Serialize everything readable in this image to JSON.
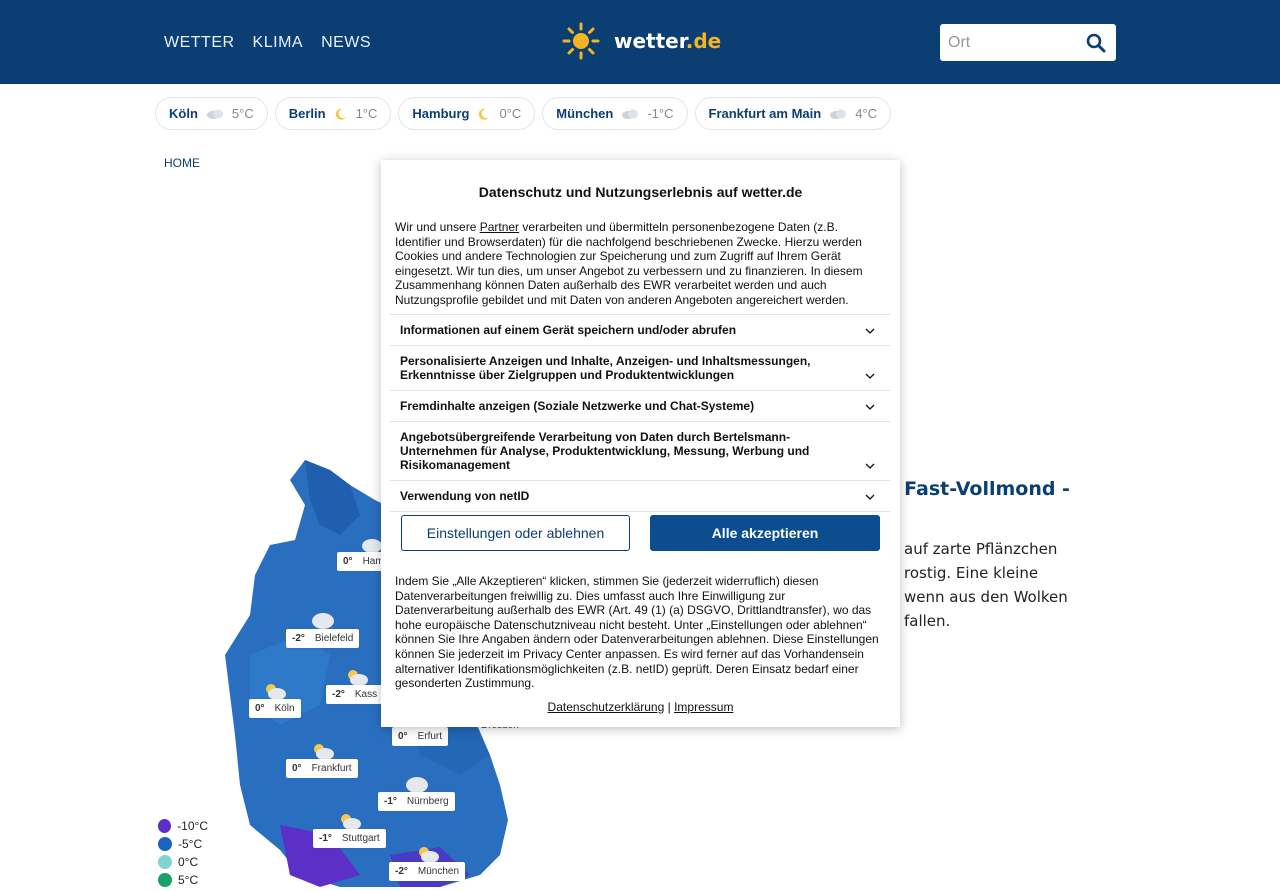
{
  "header": {
    "nav": [
      "WETTER",
      "KLIMA",
      "NEWS"
    ],
    "logo_text": "wetter",
    "logo_tld": ".de",
    "search_placeholder": "Ort"
  },
  "cities": [
    {
      "name": "Köln",
      "temp": "5°C",
      "icon": "cloud-icon"
    },
    {
      "name": "Berlin",
      "temp": "1°C",
      "icon": "moon-icon"
    },
    {
      "name": "Hamburg",
      "temp": "0°C",
      "icon": "moon-icon"
    },
    {
      "name": "München",
      "temp": "-1°C",
      "icon": "cloud-icon"
    },
    {
      "name": "Frankfurt am Main",
      "temp": "4°C",
      "icon": "cloud-icon"
    }
  ],
  "breadcrumb": "HOME",
  "article": {
    "title_partial": "n Fast-Vollmond - n",
    "text_lines": [
      "auf zarte Pflänzchen",
      "rostig. Eine kleine",
      "wenn aus den Wolken",
      "fallen."
    ]
  },
  "map": {
    "labels": [
      {
        "temp": "0°",
        "city": "Ham"
      },
      {
        "temp": "-2°",
        "city": "Bielefeld"
      },
      {
        "temp": "-2°",
        "city": "Kass"
      },
      {
        "temp": "0°",
        "city": "Köln"
      },
      {
        "temp": "0°",
        "city": "Frankfurt"
      },
      {
        "temp": "0°",
        "city": "Erfurt"
      },
      {
        "temp": "",
        "city": "Dresden"
      },
      {
        "temp": "-1°",
        "city": "Nürnberg"
      },
      {
        "temp": "-1°",
        "city": "Stuttgart"
      },
      {
        "temp": "-2°",
        "city": "München"
      }
    ],
    "legend": [
      {
        "label": "-10°C",
        "color": "#5b2fc8"
      },
      {
        "label": "-5°C",
        "color": "#1b64c2"
      },
      {
        "label": "0°C",
        "color": "#7fd3d0"
      },
      {
        "label": "5°C",
        "color": "#19a06a"
      }
    ]
  },
  "modal": {
    "title": "Datenschutz und Nutzungserlebnis auf wetter.de",
    "intro_before": "Wir und unsere ",
    "intro_link": "Partner",
    "intro_after": " verarbeiten und übermitteln personenbezogene Daten (z.B. Identifier und Browserdaten) für die nachfolgend beschriebenen Zwecke. Hierzu werden Cookies und andere Technologien zur Speicherung und zum Zugriff auf Ihrem Gerät eingesetzt. Wir tun dies, um unser Angebot zu verbessern und zu finanzieren. In diesem Zusammenhang können Daten außerhalb des EWR verarbeitet werden und auch Nutzungsprofile gebildet und mit Daten von anderen Angeboten angereichert werden.",
    "purposes": [
      "Informationen auf einem Gerät speichern und/oder abrufen",
      "Personalisierte Anzeigen und Inhalte, Anzeigen- und Inhaltsmessungen, Erkenntnisse über Zielgruppen und Produktentwicklungen",
      "Fremdinhalte anzeigen (Soziale Netzwerke und Chat-Systeme)",
      "Angebotsübergreifende Verarbeitung von Daten durch Bertelsmann-Unternehmen für Analyse, Produktentwicklung, Messung, Werbung und Risikomanagement",
      "Verwendung von netID"
    ],
    "btn_settings": "Einstellungen oder ablehnen",
    "btn_accept": "Alle akzeptieren",
    "consent": "Indem Sie „Alle Akzeptieren“ klicken, stimmen Sie (jederzeit widerruflich) diesen Datenverarbeitungen freiwillig zu. Dies umfasst auch Ihre Einwilligung zur Datenverarbeitung außerhalb des EWR (Art. 49 (1) (a) DSGVO, Drittlandtransfer), wo das hohe europäische Datenschutzniveau nicht besteht. Unter „Einstellungen oder ablehnen“ können Sie Ihre Angaben ändern oder Datenverarbeitungen ablehnen. Diese Einstellungen können Sie jederzeit im Privacy Center anpassen. Es wird ferner auf das Vorhandensein alternativer Identifikationsmöglichkeiten (z.B. netID) geprüft. Deren Einsatz bedarf einer gesonderten Zustimmung.",
    "link_privacy": "Datenschutzerklärung",
    "separator": "|",
    "link_imprint": "Impressum"
  }
}
